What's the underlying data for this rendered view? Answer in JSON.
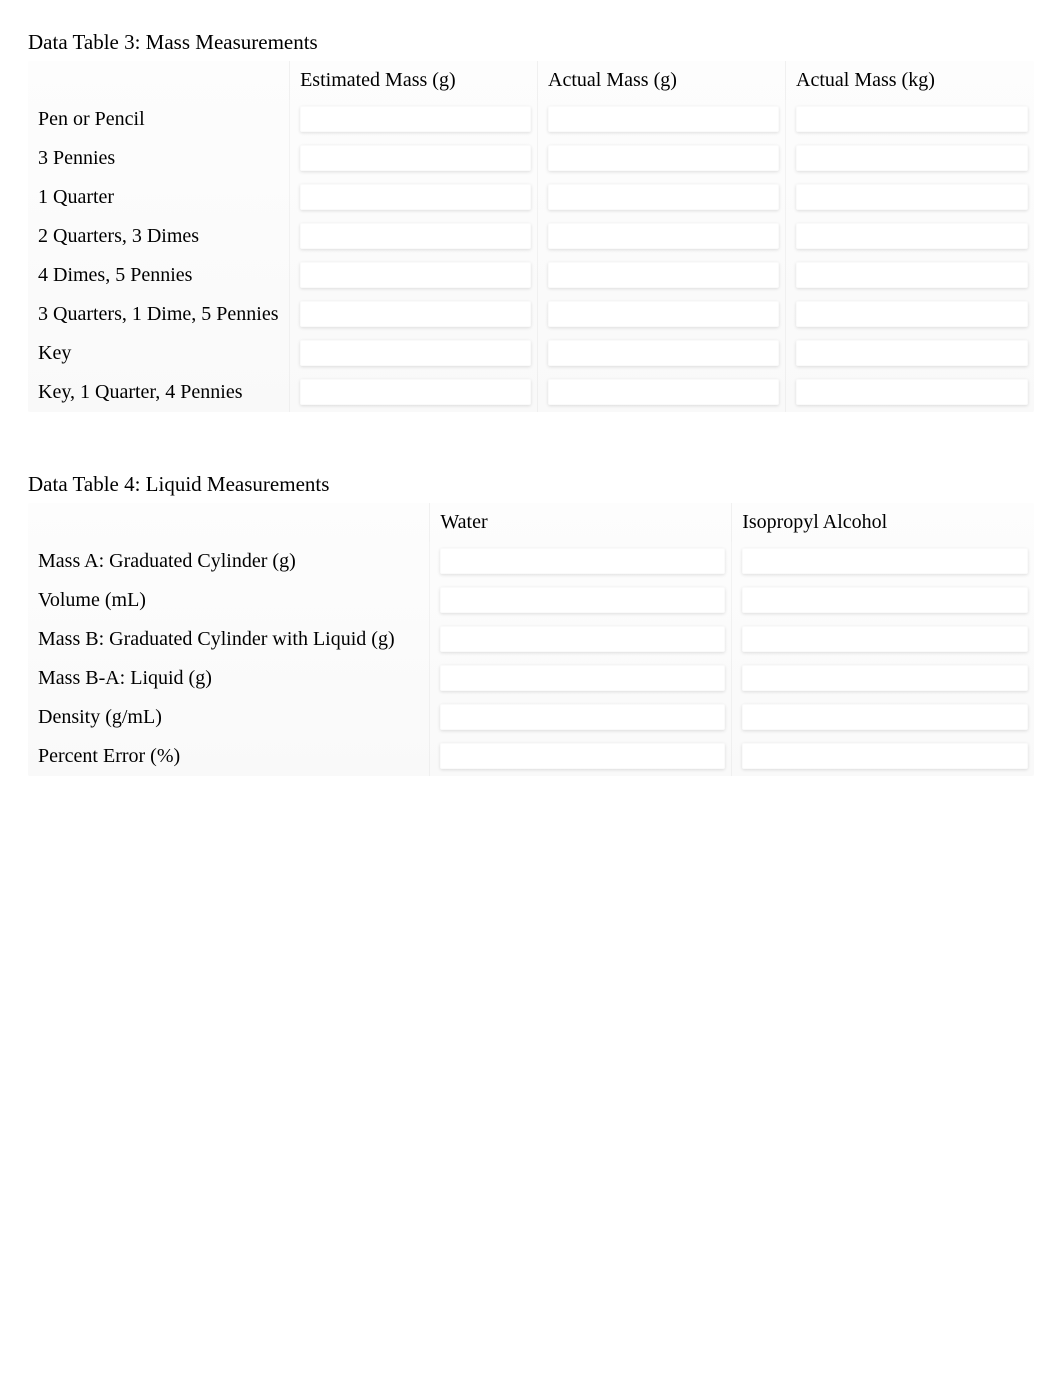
{
  "table3": {
    "title": "Data Table 3: Mass Measurements",
    "headers": {
      "blank": "",
      "col1": "Estimated  Mass  (g)",
      "col2": "Actual  Mass  (g)",
      "col3": "Actual  Mass   (kg)"
    },
    "rows": [
      {
        "label": "Pen  or Pencil",
        "c1": "",
        "c2": "",
        "c3": ""
      },
      {
        "label": "3 Pennies",
        "c1": "",
        "c2": "",
        "c3": ""
      },
      {
        "label": "1 Quarter",
        "c1": "",
        "c2": "",
        "c3": ""
      },
      {
        "label": "2 Quarters,   3 Dimes",
        "c1": "",
        "c2": "",
        "c3": ""
      },
      {
        "label": "4 Dimes,  5 Pennies",
        "c1": "",
        "c2": "",
        "c3": ""
      },
      {
        "label": "3 Quarters,   1 Dime, 5 Pennies",
        "c1": "",
        "c2": "",
        "c3": ""
      },
      {
        "label": "Key",
        "c1": "",
        "c2": "",
        "c3": ""
      },
      {
        "label": "Key, 1 Quarter,  4 Pennies",
        "c1": "",
        "c2": "",
        "c3": ""
      }
    ]
  },
  "table4": {
    "title": "Data Table 4: Liquid Measurements",
    "headers": {
      "blank": "",
      "col1": "Water",
      "col2": "Isopropyl  Alcohol"
    },
    "rows": [
      {
        "label": "Mass  A: Graduated   Cylinder (g)",
        "c1": "",
        "c2": ""
      },
      {
        "label": "Volume   (mL)",
        "c1": "",
        "c2": ""
      },
      {
        "label": "Mass  B: Graduated   Cylinder  with Liquid (g)",
        "c1": "",
        "c2": ""
      },
      {
        "label": "Mass  B-A: Liquid (g)",
        "c1": "",
        "c2": ""
      },
      {
        "label": "Density  (g/mL)",
        "c1": "",
        "c2": ""
      },
      {
        "label": "Percent   Error  (%)",
        "c1": "",
        "c2": ""
      }
    ]
  }
}
